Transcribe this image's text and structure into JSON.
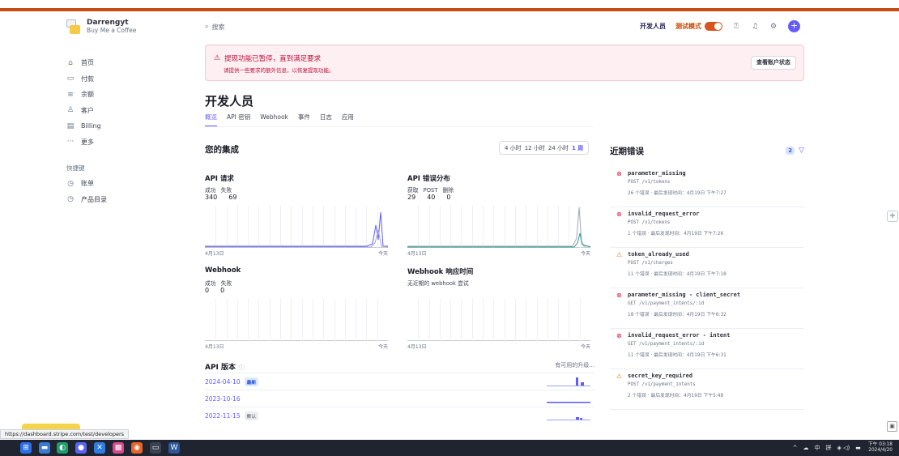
{
  "account": {
    "name": "Darrengyt",
    "subtitle": "Buy Me a Coffee"
  },
  "sidebar": {
    "items": [
      {
        "label": "首页",
        "icon": "home-icon",
        "glyph": "⌂"
      },
      {
        "label": "付款",
        "icon": "payments-icon",
        "glyph": "▭"
      },
      {
        "label": "余额",
        "icon": "balance-icon",
        "glyph": "≡"
      },
      {
        "label": "客户",
        "icon": "customers-icon",
        "glyph": "♙"
      },
      {
        "label": "Billing",
        "icon": "billing-icon",
        "glyph": "▤"
      },
      {
        "label": "更多",
        "icon": "more-icon",
        "glyph": "···"
      }
    ],
    "shortcuts_title": "快捷键",
    "shortcuts": [
      {
        "label": "账单",
        "icon": "clock-icon",
        "glyph": "◷"
      },
      {
        "label": "产品目录",
        "icon": "clock-icon",
        "glyph": "◷"
      }
    ]
  },
  "header": {
    "search_placeholder": "搜索",
    "developers_label": "开发人员",
    "test_mode_label": "测试模式"
  },
  "alert": {
    "title": "提现功能已暂停，直到满足要求",
    "description": "请提供一些要求的额外信息，以恢复提现功能。",
    "button_label": "查看账户状态"
  },
  "page": {
    "title": "开发人员",
    "tabs": [
      "概览",
      "API 密钥",
      "Webhook",
      "事件",
      "日志",
      "应用"
    ],
    "active_tab": 0
  },
  "integration": {
    "title": "您的集成",
    "ranges": [
      "4 小时",
      "12 小时",
      "24 小时",
      "1 周"
    ],
    "selected_range": 3,
    "axis_start": "4月13日",
    "axis_end": "今天",
    "metrics": {
      "api_requests": {
        "title": "API 请求",
        "labels": [
          "成功",
          "失败"
        ],
        "values": [
          "340",
          "69"
        ]
      },
      "api_errors": {
        "title": "API 错误分布",
        "labels": [
          "获取",
          "POST",
          "删除"
        ],
        "values": [
          "29",
          "40",
          "0"
        ]
      },
      "webhook": {
        "title": "Webhook",
        "labels": [
          "成功",
          "失败"
        ],
        "values": [
          "0",
          "0"
        ]
      },
      "webhook_latency": {
        "title": "Webhook 响应时间",
        "empty_text": "无近期的 webhook 尝试"
      }
    }
  },
  "api_versions": {
    "title": "API 版本",
    "available_text": "有可用的升级...",
    "rows": [
      {
        "version": "2024-04-10",
        "badge": "最新",
        "badge_type": "latest"
      },
      {
        "version": "2023-10-16",
        "badge": "",
        "badge_type": ""
      },
      {
        "version": "2022-11-15",
        "badge": "默认",
        "badge_type": "default"
      }
    ]
  },
  "recent_errors": {
    "title": "近期错误",
    "count": "2",
    "items": [
      {
        "name": "parameter_missing",
        "method_path": "POST /v1/tokens",
        "meta": "26 个错误 · 最后发现时间：4月19日 下午7:27",
        "level": "error"
      },
      {
        "name": "invalid_request_error",
        "method_path": "POST /v1/tokens",
        "meta": "1 个错误 · 最后发现时间：4月19日 下午7:26",
        "level": "error"
      },
      {
        "name": "token_already_used",
        "method_path": "POST /v1/charges",
        "meta": "11 个错误 · 最后发现时间：4月19日 下午7:18",
        "level": "warning"
      },
      {
        "name": "parameter_missing - client_secret",
        "method_path": "GET /v1/payment_intents/:id",
        "meta": "18 个错误 · 最后发现时间：4月19日 下午6:32",
        "level": "error"
      },
      {
        "name": "invalid_request_error - intent",
        "method_path": "GET /v1/payment_intents/:id",
        "meta": "11 个错误 · 最后发现时间：4月19日 下午6:31",
        "level": "error"
      },
      {
        "name": "secret_key_required",
        "method_path": "POST /v1/payment_intents",
        "meta": "2 个错误 · 最后发现时间：4月19日 下午5:48",
        "level": "warning"
      }
    ]
  },
  "status_url": "https://dashboard.stripe.com/test/developers",
  "taskbar": {
    "tray_items": [
      "^",
      "☁",
      "中",
      "拼",
      "◈ ◁)",
      "▬"
    ],
    "time": "下午 03:18",
    "date": "2024/4/20"
  },
  "colors": {
    "accent": "#635bff",
    "test_mode": "#c84801",
    "alert_text": "#c0123c",
    "top_bar": "#c44d12"
  }
}
